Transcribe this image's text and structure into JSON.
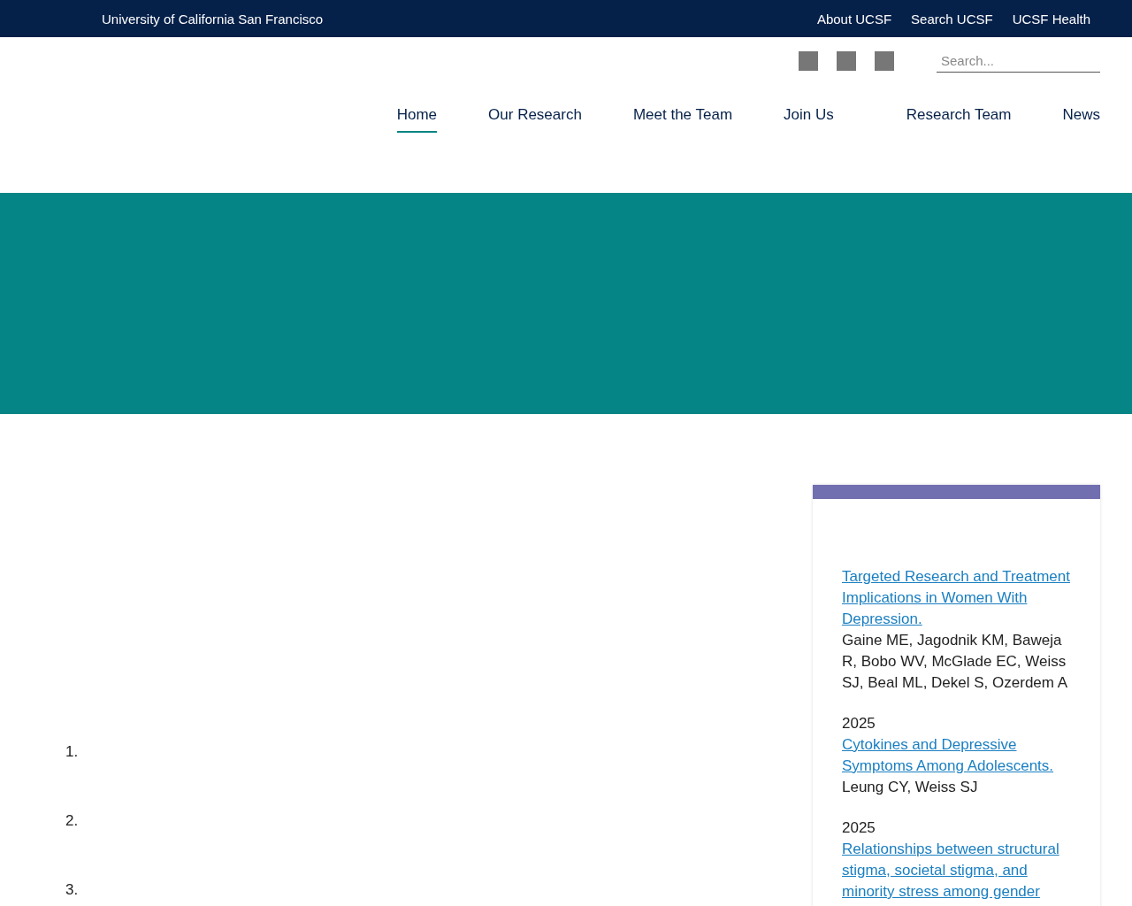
{
  "top_bar": {
    "title": "University of California San Francisco",
    "links": [
      "About UCSF",
      "Search UCSF",
      "UCSF Health"
    ]
  },
  "search": {
    "placeholder": "Search..."
  },
  "nav": [
    {
      "label": "Home",
      "selected": true
    },
    {
      "label": "Our Research",
      "selected": false
    },
    {
      "label": "Meet the Team",
      "selected": false
    },
    {
      "label": "Join Us",
      "selected": false
    },
    {
      "label": "Research Team",
      "selected": false
    },
    {
      "label": "News",
      "selected": false
    }
  ],
  "list_numbers": [
    "1.",
    "2.",
    "3."
  ],
  "publications": [
    {
      "title": "Targeted Research and Treatment Implications in Women With Depression.",
      "authors": "Gaine ME, Jagodnik KM, Baweja R, Bobo WV, McGlade EC, Weiss SJ, Beal ML, Dekel S, Ozerdem A"
    },
    {
      "year": "2025",
      "title": "Cytokines and Depressive Symptoms Among Adolescents.",
      "authors": "Leung CY, Weiss SJ"
    },
    {
      "year": "2025",
      "title": "Relationships between structural stigma, societal stigma, and minority stress among gender"
    }
  ]
}
